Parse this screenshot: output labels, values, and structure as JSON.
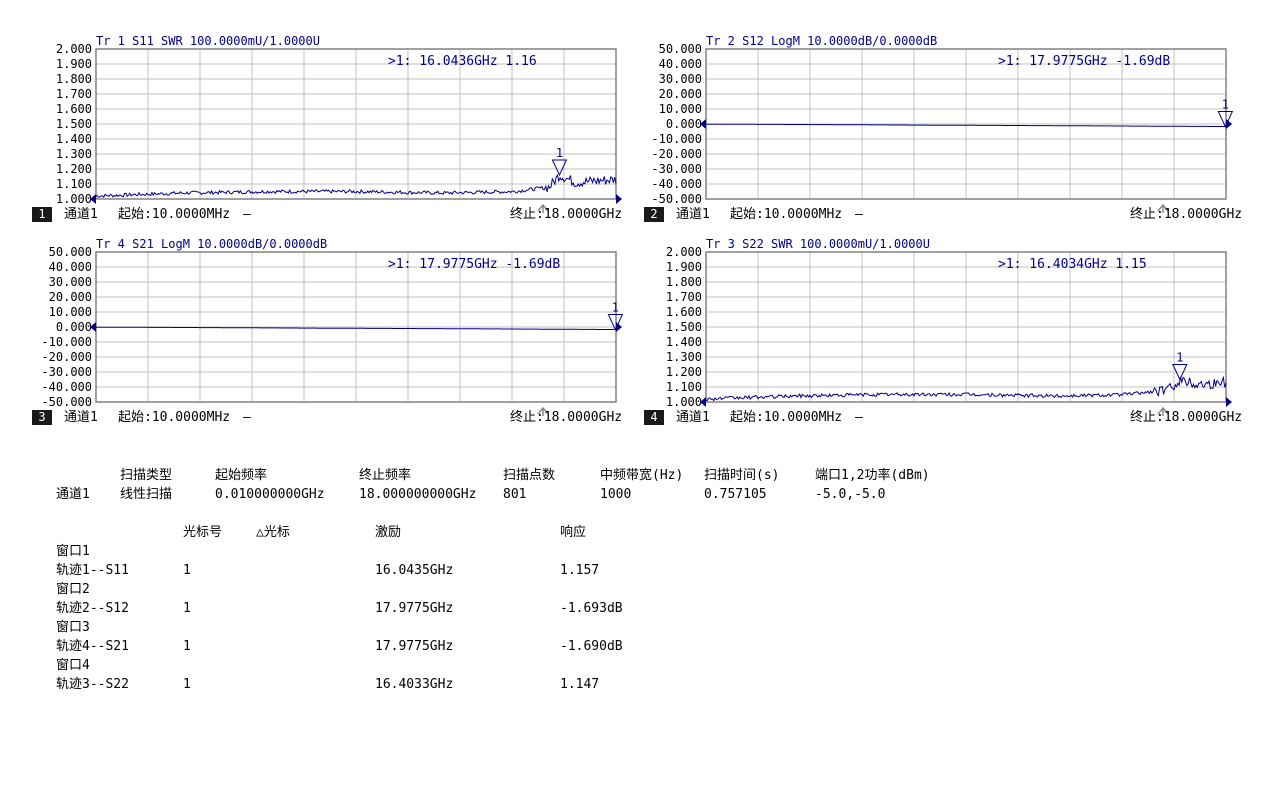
{
  "colors": {
    "trace": "#00008b",
    "grid": "#c0c0c0",
    "frame": "#808080",
    "marker": "#00008b"
  },
  "chart_data": [
    {
      "type": "line",
      "channel_number": "1",
      "trace_header": "Tr 1  S11 SWR 100.0000mU/1.0000U",
      "marker_readout": ">1:  16.0436GHz 1.16",
      "marker_label": "1",
      "marker_x_ghz": 16.0436,
      "marker_value": 1.16,
      "y_ticks": [
        "2.000",
        "1.900",
        "1.800",
        "1.700",
        "1.600",
        "1.500",
        "1.400",
        "1.300",
        "1.200",
        "1.100",
        "1.000"
      ],
      "ylim": [
        1.0,
        2.0
      ],
      "xlim_ghz": [
        0.01,
        18.0
      ],
      "reference_level": 1.0,
      "channel_label": "通道1",
      "start_label": "起始:10.0000MHz",
      "stop_label": "终止:18.0000GHz",
      "dash": "—",
      "series": [
        {
          "x_ghz": [
            0.01,
            3.0,
            6.0,
            9.0,
            12.0,
            14.5,
            15.7,
            16.04,
            16.6,
            17.2,
            18.0
          ],
          "values": [
            1.02,
            1.04,
            1.05,
            1.05,
            1.04,
            1.05,
            1.08,
            1.16,
            1.11,
            1.12,
            1.13
          ]
        }
      ]
    },
    {
      "type": "line",
      "channel_number": "2",
      "trace_header": "Tr 2  S12 LogM 10.0000dB/0.0000dB",
      "marker_readout": ">1:  17.9775GHz -1.69dB",
      "marker_label": "1",
      "marker_x_ghz": 17.9775,
      "marker_value": -1.69,
      "y_ticks": [
        "50.000",
        "40.000",
        "30.000",
        "20.000",
        "10.000",
        "0.000",
        "-10.000",
        "-20.000",
        "-30.000",
        "-40.000",
        "-50.000"
      ],
      "ylim": [
        -50.0,
        50.0
      ],
      "xlim_ghz": [
        0.01,
        18.0
      ],
      "reference_level": 0.0,
      "channel_label": "通道1",
      "start_label": "起始:10.0000MHz",
      "stop_label": "终止:18.0000GHz",
      "dash": "—",
      "series": [
        {
          "x_ghz": [
            0.01,
            4.0,
            8.0,
            12.0,
            16.0,
            18.0
          ],
          "values": [
            -0.1,
            -0.4,
            -0.8,
            -1.1,
            -1.5,
            -1.7
          ]
        }
      ]
    },
    {
      "type": "line",
      "channel_number": "3",
      "trace_header": "Tr 4  S21 LogM 10.0000dB/0.0000dB",
      "marker_readout": ">1:  17.9775GHz -1.69dB",
      "marker_label": "1",
      "marker_x_ghz": 17.9775,
      "marker_value": -1.69,
      "y_ticks": [
        "50.000",
        "40.000",
        "30.000",
        "20.000",
        "10.000",
        "0.000",
        "-10.000",
        "-20.000",
        "-30.000",
        "-40.000",
        "-50.000"
      ],
      "ylim": [
        -50.0,
        50.0
      ],
      "xlim_ghz": [
        0.01,
        18.0
      ],
      "reference_level": 0.0,
      "channel_label": "通道1",
      "start_label": "起始:10.0000MHz",
      "stop_label": "终止:18.0000GHz",
      "dash": "—",
      "series": [
        {
          "x_ghz": [
            0.01,
            4.0,
            8.0,
            12.0,
            16.0,
            18.0
          ],
          "values": [
            -0.1,
            -0.4,
            -0.8,
            -1.1,
            -1.5,
            -1.7
          ]
        }
      ]
    },
    {
      "type": "line",
      "channel_number": "4",
      "trace_header": "Tr 3  S22 SWR 100.0000mU/1.0000U",
      "marker_readout": ">1:  16.4034GHz 1.15",
      "marker_label": "1",
      "marker_x_ghz": 16.4034,
      "marker_value": 1.15,
      "y_ticks": [
        "2.000",
        "1.900",
        "1.800",
        "1.700",
        "1.600",
        "1.500",
        "1.400",
        "1.300",
        "1.200",
        "1.100",
        "1.000"
      ],
      "ylim": [
        1.0,
        2.0
      ],
      "xlim_ghz": [
        0.01,
        18.0
      ],
      "reference_level": 1.0,
      "channel_label": "通道1",
      "start_label": "起始:10.0000MHz",
      "stop_label": "终止:18.0000GHz",
      "dash": "—",
      "series": [
        {
          "x_ghz": [
            0.01,
            3.0,
            6.0,
            9.0,
            12.0,
            14.5,
            16.0,
            16.4,
            17.0,
            18.0
          ],
          "values": [
            1.02,
            1.04,
            1.05,
            1.05,
            1.04,
            1.05,
            1.08,
            1.15,
            1.12,
            1.13
          ]
        }
      ]
    }
  ],
  "summary": {
    "headers": [
      "扫描类型",
      "起始频率",
      "终止频率",
      "扫描点数",
      "中频带宽(Hz)",
      "扫描时间(s)",
      "端口1,2功率(dBm)"
    ],
    "row_label": "通道1",
    "row_values": [
      "线性扫描",
      "0.010000000GHz",
      "18.000000000GHz",
      "801",
      "1000",
      "0.757105",
      "-5.0,-5.0"
    ]
  },
  "marker_table": {
    "headers": [
      "光标号",
      "△光标",
      "激励",
      "响应"
    ],
    "windows": [
      {
        "window": "窗口1",
        "trace": "轨迹1--S11",
        "marker": "1",
        "stimulus": "16.0435GHz",
        "response": "1.157"
      },
      {
        "window": "窗口2",
        "trace": "轨迹2--S12",
        "marker": "1",
        "stimulus": "17.9775GHz",
        "response": "-1.693dB"
      },
      {
        "window": "窗口3",
        "trace": "轨迹4--S21",
        "marker": "1",
        "stimulus": "17.9775GHz",
        "response": "-1.690dB"
      },
      {
        "window": "窗口4",
        "trace": "轨迹3--S22",
        "marker": "1",
        "stimulus": "16.4033GHz",
        "response": "1.147"
      }
    ]
  }
}
